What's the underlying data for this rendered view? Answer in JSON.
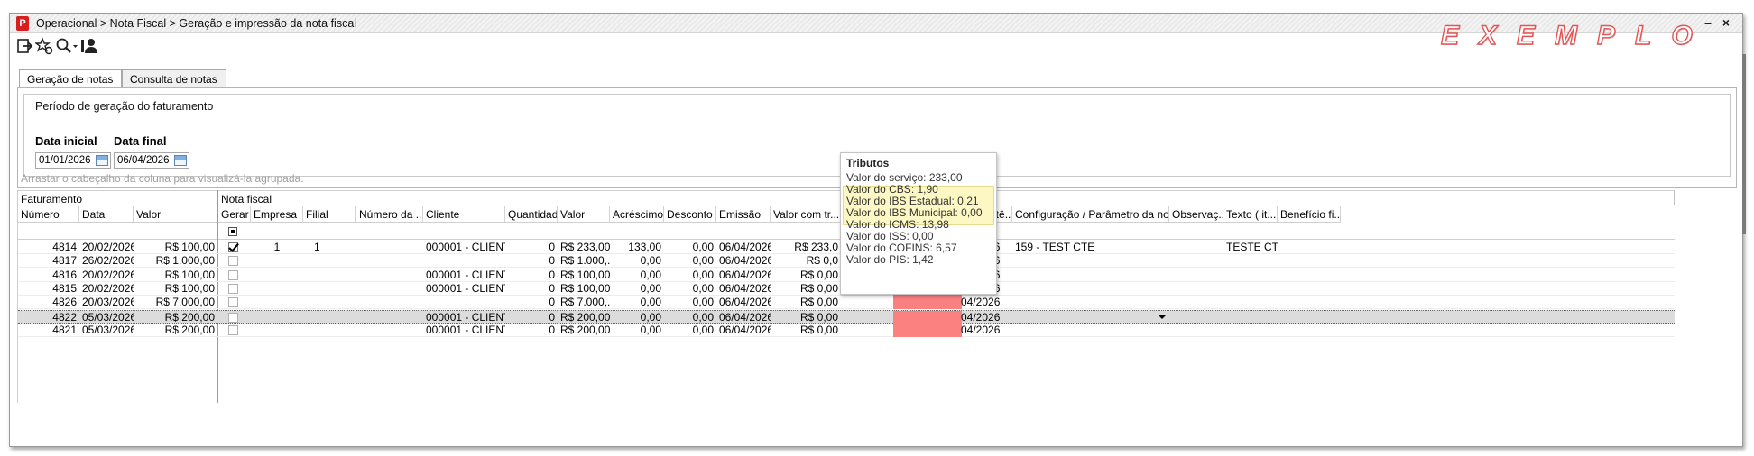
{
  "window": {
    "breadcrumb": "Operacional > Nota Fiscal > Geração e impressão da nota fiscal",
    "watermark": "EXEMPLO",
    "minimize": "–",
    "close": "×"
  },
  "toolbar": {
    "icons": [
      "exit-icon",
      "favorite-star-icon",
      "search-icon",
      "user-icon"
    ]
  },
  "tabs": [
    {
      "label": "Geração de notas",
      "active": true
    },
    {
      "label": "Consulta de notas",
      "active": false
    }
  ],
  "period": {
    "title": "Período de geração do faturamento",
    "start_label": "Data inicial",
    "start_value": "01/01/2026",
    "end_label": "Data final",
    "end_value": "06/04/2026"
  },
  "group_hint": "Arrastar o cabeçalho da coluna para visualizá-la agrupada.",
  "grid": {
    "bands": {
      "faturamento": "Faturamento",
      "nota_fiscal": "Nota fiscal"
    },
    "columns": [
      "Número",
      "Data",
      "Valor",
      "Gerar",
      "Empresa",
      "Filial",
      "Número da ...",
      "Cliente",
      "Quantidade",
      "Valor",
      "Acréscimo",
      "Desconto",
      "Emissão",
      "Valor com tr...",
      "",
      "Competê...",
      "Configuração / Parâmetro da nota...",
      "Observaç...",
      "Texto ( it...",
      "Benefício fi..."
    ],
    "rows": [
      {
        "numero": "4814",
        "data": "20/02/2026",
        "valor": "R$ 100,00",
        "gerar": true,
        "empresa": "1",
        "filial": "1",
        "cliente": "000001 - CLIENT...",
        "quantidade": "0",
        "valor_nf": "R$ 233,00",
        "acrescimo": "133,00",
        "desconto": "0,00",
        "emissao": "06/04/2026",
        "valor_tr": "R$ 233,0",
        "competencia": "04/2026",
        "config": "159 - TEST CTE",
        "texto": "TESTE CTE",
        "selected": false
      },
      {
        "numero": "4817",
        "data": "26/02/2026",
        "valor": "R$ 1.000,00",
        "gerar": false,
        "empresa": "",
        "filial": "",
        "cliente": "",
        "quantidade": "0",
        "valor_nf": "R$ 1.000,...",
        "acrescimo": "0,00",
        "desconto": "0,00",
        "emissao": "06/04/2026",
        "valor_tr": "R$ 0,0",
        "competencia": "04/2026",
        "config": "",
        "texto": "",
        "selected": false
      },
      {
        "numero": "4816",
        "data": "20/02/2026",
        "valor": "R$ 100,00",
        "gerar": false,
        "empresa": "",
        "filial": "",
        "cliente": "000001 - CLIENT...",
        "quantidade": "0",
        "valor_nf": "R$ 100,00",
        "acrescimo": "0,00",
        "desconto": "0,00",
        "emissao": "06/04/2026",
        "valor_tr": "R$ 0,00",
        "competencia": "04/2026",
        "config": "",
        "texto": "",
        "selected": false
      },
      {
        "numero": "4815",
        "data": "20/02/2026",
        "valor": "R$ 100,00",
        "gerar": false,
        "empresa": "",
        "filial": "",
        "cliente": "000001 - CLIENT...",
        "quantidade": "0",
        "valor_nf": "R$ 100,00",
        "acrescimo": "0,00",
        "desconto": "0,00",
        "emissao": "06/04/2026",
        "valor_tr": "R$ 0,00",
        "competencia": "04/2026",
        "config": "",
        "texto": "",
        "selected": false
      },
      {
        "numero": "4826",
        "data": "20/03/2026",
        "valor": "R$ 7.000,00",
        "gerar": false,
        "empresa": "",
        "filial": "",
        "cliente": "",
        "quantidade": "0",
        "valor_nf": "R$ 7.000,...",
        "acrescimo": "0,00",
        "desconto": "0,00",
        "emissao": "06/04/2026",
        "valor_tr": "R$ 0,00",
        "competencia": "04/2026",
        "config": "",
        "texto": "",
        "selected": false
      },
      {
        "numero": "4822",
        "data": "05/03/2026",
        "valor": "R$ 200,00",
        "gerar": false,
        "empresa": "",
        "filial": "",
        "cliente": "000001 - CLIENT...",
        "quantidade": "0",
        "valor_nf": "R$ 200,00",
        "acrescimo": "0,00",
        "desconto": "0,00",
        "emissao": "06/04/2026",
        "valor_tr": "R$ 0,00",
        "competencia": "04/2026",
        "config": "",
        "texto": "",
        "selected": true
      },
      {
        "numero": "4821",
        "data": "05/03/2026",
        "valor": "R$ 200,00",
        "gerar": false,
        "empresa": "",
        "filial": "",
        "cliente": "000001 - CLIENT...",
        "quantidade": "0",
        "valor_nf": "R$ 200,00",
        "acrescimo": "0,00",
        "desconto": "0,00",
        "emissao": "06/04/2026",
        "valor_tr": "R$ 0,00",
        "competencia": "04/2026",
        "config": "",
        "texto": "",
        "selected": false
      }
    ]
  },
  "tooltip": {
    "title": "Tributos",
    "lines": [
      "Valor do serviço: 233,00",
      "Valor do CBS: 1,90",
      "Valor do IBS Estadual: 0,21",
      "Valor do IBS Municipal: 0,00",
      "Valor do ICMS: 13,98",
      "Valor do ISS: 0,00",
      "Valor do COFINS: 6,57",
      "Valor do PIS: 1,42"
    ]
  },
  "colors": {
    "brand": "#d81e1e",
    "watermark_stroke": "#e25555",
    "tax_cell": "#fb8080",
    "tooltip_highlight": "#fdf7c3",
    "selected_row": "#dcdcdc"
  }
}
